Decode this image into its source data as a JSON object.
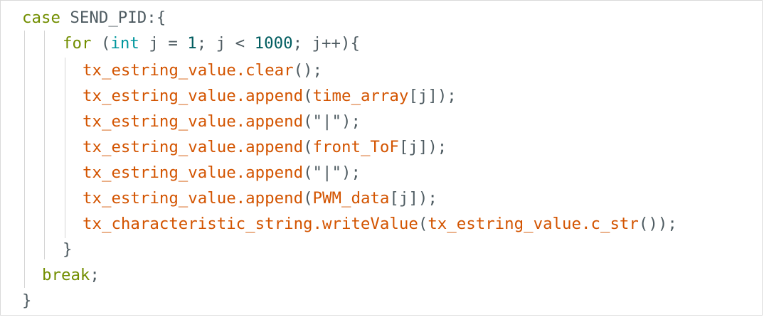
{
  "code": {
    "line1": {
      "keyword": "case",
      "label": " SEND_PID:{"
    },
    "line2": {
      "kw_for": "for",
      "paren_open": " (",
      "kw_int": "int",
      "decl": " j = ",
      "num_start": "1",
      "cond": "; j < ",
      "num_end": "1000",
      "incr": "; j++){"
    },
    "line3": {
      "obj": "tx_estring_value.",
      "method": "clear",
      "args": "();"
    },
    "line4": {
      "obj": "tx_estring_value.",
      "method": "append",
      "paren_open": "(",
      "arg": "time_array",
      "index": "[j]",
      "close": ");"
    },
    "line5": {
      "obj": "tx_estring_value.",
      "method": "append",
      "paren_open": "(",
      "arg": "\"|\"",
      "close": ");"
    },
    "line6": {
      "obj": "tx_estring_value.",
      "method": "append",
      "paren_open": "(",
      "arg": "front_ToF",
      "index": "[j]",
      "close": ");"
    },
    "line7": {
      "obj": "tx_estring_value.",
      "method": "append",
      "paren_open": "(",
      "arg": "\"|\"",
      "close": ");"
    },
    "line8": {
      "obj": "tx_estring_value.",
      "method": "append",
      "paren_open": "(",
      "arg": "PWM_data",
      "index": "[j]",
      "close": ");"
    },
    "line9": {
      "obj": "tx_characteristic_string.",
      "method": "writeValue",
      "paren_open": "(",
      "arg_obj": "tx_estring_value.",
      "arg_method": "c_str",
      "close": "());"
    },
    "line10": {
      "brace": "}"
    },
    "line11": {
      "keyword": "break",
      "semi": ";"
    },
    "line12": {
      "brace": "}"
    }
  },
  "colors": {
    "keyword": "#728e00",
    "type": "#00979d",
    "number": "#005c5f",
    "function": "#d35400",
    "plain": "#4e5b61",
    "guide": "#d4d4d4",
    "border": "#d9d9d9"
  }
}
